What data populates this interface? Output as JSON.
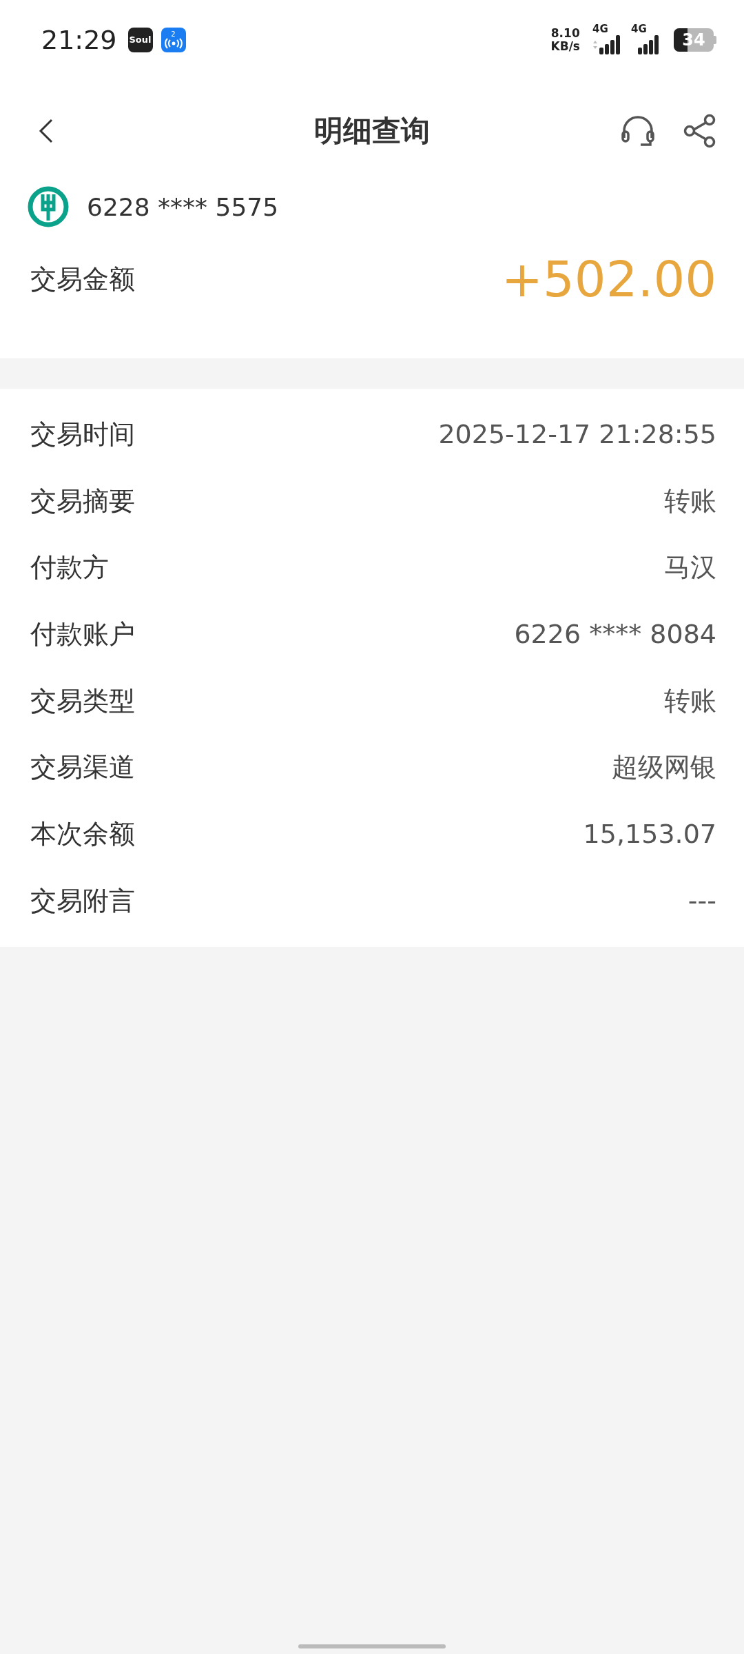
{
  "status_bar": {
    "time": "21:29",
    "notifications": [
      {
        "kind": "app",
        "label": "Soul"
      },
      {
        "kind": "hotspot",
        "badge": "2"
      }
    ],
    "net_speed": "8.10",
    "net_unit": "KB/s",
    "signals": [
      {
        "label": "4G",
        "arrows": true
      },
      {
        "label": "4G",
        "arrows": false
      }
    ],
    "battery": "34"
  },
  "header": {
    "title": "明细查询"
  },
  "account": {
    "number": "6228 **** 5575"
  },
  "amount": {
    "label": "交易金额",
    "value": "+502.00"
  },
  "details": [
    {
      "label": "交易时间",
      "value": "2025-12-17 21:28:55"
    },
    {
      "label": "交易摘要",
      "value": "转账"
    },
    {
      "label": "付款方",
      "value": "马汉"
    },
    {
      "label": "付款账户",
      "value": "6226 **** 8084"
    },
    {
      "label": "交易类型",
      "value": "转账"
    },
    {
      "label": "交易渠道",
      "value": "超级网银"
    },
    {
      "label": "本次余额",
      "value": "15,153.07"
    },
    {
      "label": "交易附言",
      "value": "---"
    }
  ]
}
